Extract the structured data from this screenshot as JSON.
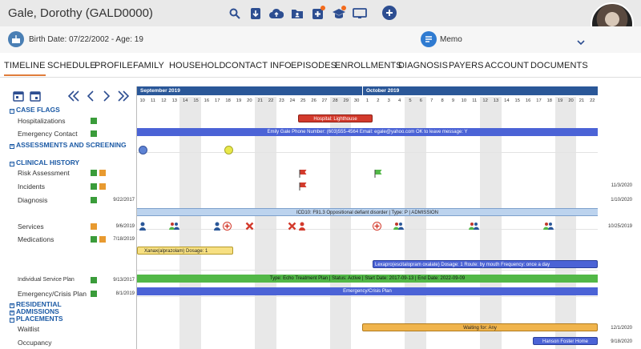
{
  "header": {
    "patient_name": "Gale, Dorothy (GALD0000)",
    "birth_date_text": "Birth Date: 07/22/2002 - Age: 19",
    "memo_label": "Memo",
    "icons": [
      "search-icon",
      "download-icon",
      "cloud-upload-icon",
      "folder-user-icon",
      "medical-plus-icon",
      "graduation-cap-icon",
      "monitor-icon"
    ]
  },
  "tabs": [
    "TIMELINE",
    "SCHEDULE",
    "PROFILE",
    "FAMILY",
    "HOUSEHOLD",
    "CONTACT INFO",
    "EPISODES",
    "ENROLLMENTS",
    "DIAGNOSIS",
    "PAYERS",
    "ACCOUNT",
    "DOCUMENTS"
  ],
  "active_tab": "TIMELINE",
  "timeline": {
    "months": [
      "September 2019",
      "October 2019"
    ],
    "days": [
      "10",
      "11",
      "12",
      "13",
      "14",
      "15",
      "16",
      "17",
      "18",
      "19",
      "20",
      "21",
      "22",
      "23",
      "24",
      "25",
      "26",
      "27",
      "28",
      "29",
      "30",
      "1",
      "2",
      "3",
      "4",
      "5",
      "6",
      "7",
      "8",
      "9",
      "10",
      "11",
      "12",
      "13",
      "14",
      "15",
      "16",
      "17",
      "18",
      "19",
      "20",
      "21",
      "22"
    ]
  },
  "rows": {
    "case_flags": "CASE FLAGS",
    "hospitalizations": "Hospitalizations",
    "emergency_contact": "Emergency Contact",
    "assessments": "ASSESSMENTS AND SCREENING",
    "clinical_history": "CLINICAL HISTORY",
    "risk_assessment": "Risk Assessment",
    "incidents": "Incidents",
    "diagnosis": "Diagnosis",
    "services": "Services",
    "medications": "Medications",
    "isp": "Individual Service Plan",
    "ecp": "Emergency/Crisis Plan",
    "residential": "RESIDENTIAL",
    "admissions": "ADMISSIONS",
    "placements": "PLACEMENTS",
    "waitlist": "Waitlist",
    "occupancy": "Occupancy"
  },
  "dates_left": {
    "diagnosis": "9/22/2017",
    "services": "9/6/2019",
    "medications": "7/18/2019",
    "isp": "9/13/2017",
    "ecp": "8/1/2019"
  },
  "dates_right": {
    "incidents": "11/3/2020",
    "diagnosis": "1/10/2020",
    "services": "10/25/2019",
    "waitlist": "12/1/2020",
    "occupancy": "9/18/2020"
  },
  "bars": {
    "hospital": "Hospital: Lighthouse",
    "emergency": "Emily Gale Phone Number: (603)555-4564 Email: egale@yahoo.com OK to leave message: Y",
    "icd": "ICD10: F91.3 Oppositional defiant disorder | Type: P | ADMISSION",
    "xanax": "Xanax(alprazolam) Dosage: 1",
    "lexapro": "Lexapro(escitalopram oxalate) Dosage: 1 Route: by mouth Frequency: once a day",
    "isp": "Type: Echo Treatment Plan | Status: Active | Start Date: 2017-09-13 | End Date: 2022-09-09",
    "ecp": "Emergency/Crisis Plan",
    "waitlist": "Waiting for: Any",
    "occupancy": "Hanson Foster Home"
  },
  "colors": {
    "accent_blue": "#2a5798",
    "hospital_red": "#d33a2c",
    "emergency_blue": "#4b63d6",
    "icd_lightblue": "#bcd3ee",
    "med_yellow": "#f7e082",
    "isp_green": "#52b847",
    "waitlist_orange": "#f0b44c",
    "tab_underline": "#e07c3a"
  }
}
